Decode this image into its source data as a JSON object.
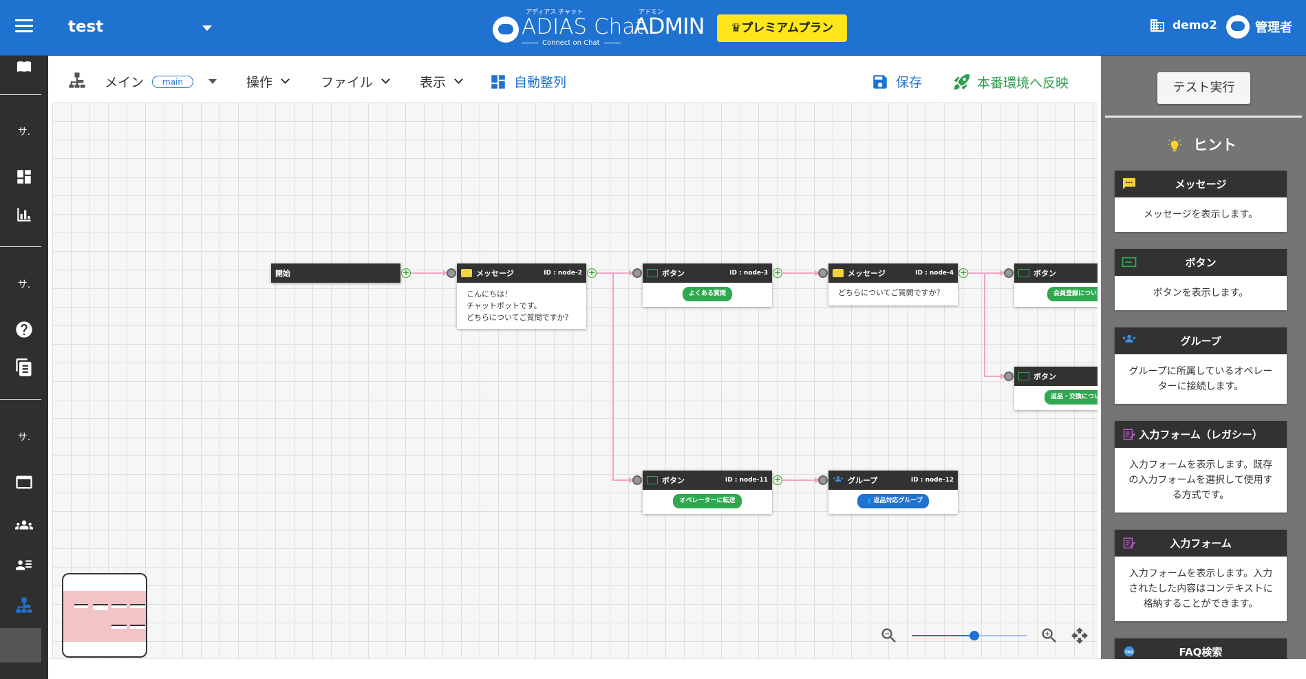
{
  "header": {
    "bot_name": "test",
    "logo_ruby_left": "アディアス チャット",
    "logo_ruby_right": "アドミン",
    "logo_name": "ADIAS Chat",
    "logo_admin": "ADMIN",
    "logo_tagline": "Connect on Chat",
    "premium_label": "♛プレミアムプラン",
    "tenant": "demo2",
    "user": "管理者"
  },
  "sidebar": {
    "section_labels": [
      "サ.",
      "サ.",
      "サ."
    ]
  },
  "toolbar": {
    "flow_name": "メイン",
    "flow_id": "main",
    "operate": "操作",
    "file": "ファイル",
    "view": "表示",
    "auto_align": "自動整列",
    "save": "保存",
    "deploy": "本番環境へ反映"
  },
  "nodes": {
    "start": {
      "title": "開始"
    },
    "node2": {
      "title": "メッセージ",
      "id": "ID : node-2",
      "lines": [
        "こんにちは！",
        "チャットボットです。",
        "どちらについてご質問ですか？"
      ]
    },
    "node3": {
      "title": "ボタン",
      "id": "ID : node-3",
      "button": "よくある質問"
    },
    "node4": {
      "title": "メッセージ",
      "id": "ID : node-4",
      "text": "どちらについてご質問ですか？"
    },
    "node5": {
      "title": "ボタン",
      "button": "会員登録につい"
    },
    "node6": {
      "title": "ボタン",
      "button": "返品・交換につい"
    },
    "node11": {
      "title": "ボタン",
      "id": "ID : node-11",
      "button": "オペレーターに転送"
    },
    "node12": {
      "title": "グループ",
      "id": "ID : node-12",
      "button": "返品対応グループ"
    }
  },
  "zoom": {
    "level": 0.55
  },
  "right_panel": {
    "test_run": "テスト実行",
    "hint_title": "ヒント",
    "cards": [
      {
        "title": "メッセージ",
        "body": "メッセージを表示します。",
        "icon": "message-icon"
      },
      {
        "title": "ボタン",
        "body": "ボタンを表示します。",
        "icon": "button-icon"
      },
      {
        "title": "グループ",
        "body": "グループに所属しているオペレーターに接続します。",
        "icon": "group-icon"
      },
      {
        "title": "入力フォーム（レガシー）",
        "body": "入力フォームを表示します。既存の入力フォームを選択して使用する方式です。",
        "icon": "form-legacy-icon"
      },
      {
        "title": "入力フォーム",
        "body": "入力フォームを表示します。入力されたした内容はコンテキストに格納することができます。",
        "icon": "form-icon"
      },
      {
        "title": "FAQ検索",
        "body": "",
        "icon": "faq-icon"
      }
    ]
  },
  "colors": {
    "header": "#1f72d0",
    "premium": "#ffe61a",
    "sidebar": "#2f2f2f",
    "connector": "#f3a3c8",
    "button_chip": "#2fa84f"
  }
}
